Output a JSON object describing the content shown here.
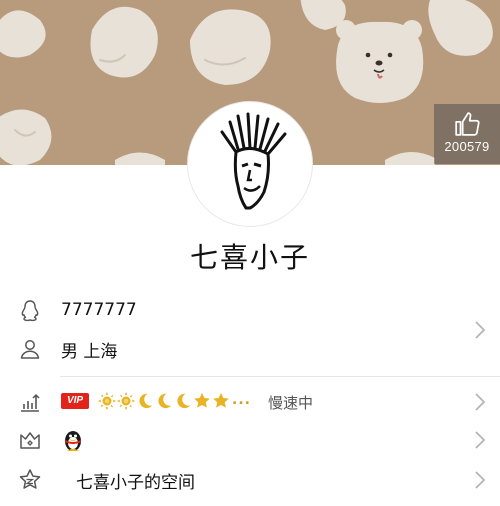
{
  "profile": {
    "like_count": "200579",
    "nickname": "七喜小子"
  },
  "info": {
    "qq_number": "7777777",
    "gender_location": "男 上海"
  },
  "level": {
    "vip_badge": "VIP",
    "level_icons": [
      "sun",
      "sun",
      "moon",
      "moon",
      "moon",
      "star",
      "star"
    ],
    "more": "...",
    "speed_status": "慢速中"
  },
  "space": {
    "label": "七喜小子的空间"
  },
  "colors": {
    "cover_bg": "#b89a7c",
    "vip_red": "#e2231a",
    "level_gold": "#e8b324"
  }
}
